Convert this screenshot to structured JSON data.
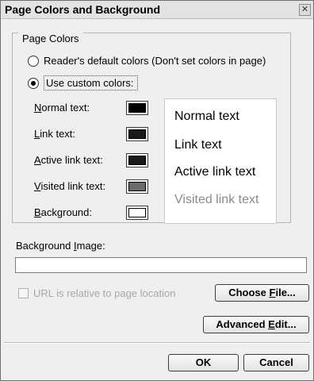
{
  "dialog": {
    "title": "Page Colors and Background",
    "close_glyph": "✕"
  },
  "page_colors": {
    "legend": "Page Colors",
    "option_default": "Reader's default colors (Don't set colors in page)",
    "option_custom": "Use custom colors:",
    "selected": "custom"
  },
  "color_rows": [
    {
      "pre": "",
      "ul": "N",
      "post": "ormal text:",
      "color": "#000000"
    },
    {
      "pre": "",
      "ul": "L",
      "post": "ink text:",
      "color": "#1a1a1a"
    },
    {
      "pre": "",
      "ul": "A",
      "post": "ctive link text:",
      "color": "#1a1a1a"
    },
    {
      "pre": "",
      "ul": "V",
      "post": "isited link text:",
      "color": "#6b6b6b"
    },
    {
      "pre": "",
      "ul": "B",
      "post": "ackground:",
      "color": "#ffffff"
    }
  ],
  "preview": {
    "normal": "Normal text",
    "link": "Link text",
    "active": "Active link text",
    "visited": "Visited link text",
    "visited_color": "#8a8a8a"
  },
  "background_image": {
    "label_pre": "Background ",
    "label_ul": "I",
    "label_post": "mage:",
    "value": ""
  },
  "relative_checkbox": {
    "label": "URL is relative to page location",
    "checked": false
  },
  "buttons": {
    "choose_file_pre": "Choose ",
    "choose_file_ul": "F",
    "choose_file_post": "ile...",
    "advanced_pre": "Advanced ",
    "advanced_ul": "E",
    "advanced_post": "dit...",
    "ok": "OK",
    "cancel": "Cancel"
  }
}
